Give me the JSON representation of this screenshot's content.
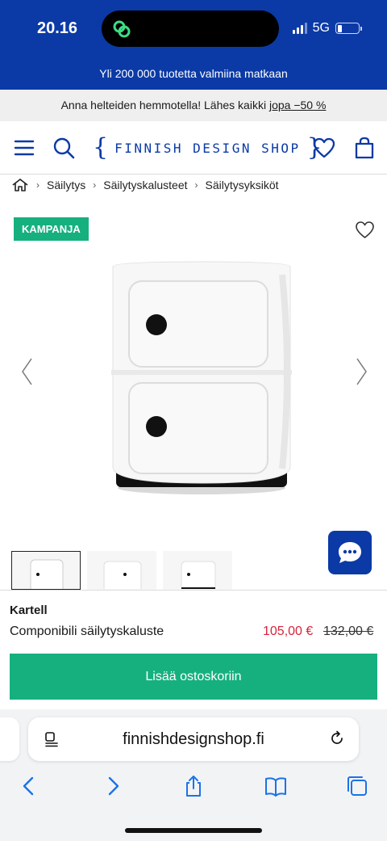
{
  "status_bar": {
    "time": "20.16",
    "network": "5G"
  },
  "promo": {
    "line1": "Yli 200 000 tuotetta valmiina matkaan",
    "line2_text": "Anna helteiden hemmotella! Lähes kaikki ",
    "line2_link": "jopa −50 %"
  },
  "header": {
    "logo_open": "{",
    "logo_text": "FINNISH DESIGN SHOP",
    "logo_close": "}",
    "icons": [
      "menu-icon",
      "search-icon",
      "heart-icon",
      "bag-icon"
    ]
  },
  "breadcrumb": {
    "separator": "›",
    "items": [
      "Säilytys",
      "Säilytyskalusteet",
      "Säilytysyksiköt"
    ]
  },
  "gallery": {
    "badge": "KAMPANJA"
  },
  "product": {
    "brand": "Kartell",
    "name": "Componibili säilytyskaluste",
    "price_sale": "105,00 €",
    "price_old": "132,00 €",
    "add_to_cart": "Lisää ostoskoriin"
  },
  "browser": {
    "url": "finnishdesignshop.fi"
  },
  "colors": {
    "brand_blue": "#0b3aa6",
    "accent_green": "#16b07f",
    "sale_red": "#d8243c",
    "ios_blue": "#1a73e8"
  }
}
